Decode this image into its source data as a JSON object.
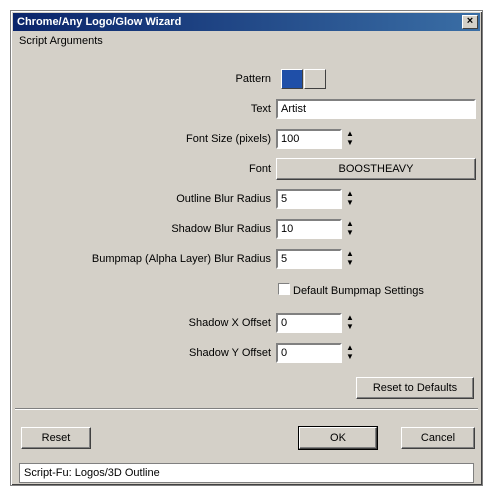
{
  "window": {
    "title": "Chrome/Any Logo/Glow Wizard",
    "close_glyph": "×"
  },
  "group_label": "Script Arguments",
  "fields": {
    "pattern_label": "Pattern",
    "text_label": "Text",
    "text_value": "Artist",
    "font_size_label": "Font Size (pixels)",
    "font_size_value": "100",
    "font_label": "Font",
    "font_value": "BOOSTHEAVY",
    "outline_blur_label": "Outline Blur Radius",
    "outline_blur_value": "5",
    "shadow_blur_label": "Shadow Blur Radius",
    "shadow_blur_value": "10",
    "bump_blur_label": "Bumpmap (Alpha Layer) Blur Radius",
    "bump_blur_value": "5",
    "default_bump_label": "Default Bumpmap Settings",
    "shadow_x_label": "Shadow X Offset",
    "shadow_x_value": "0",
    "shadow_y_label": "Shadow Y Offset",
    "shadow_y_value": "0"
  },
  "buttons": {
    "reset_defaults": "Reset to Defaults",
    "reset": "Reset",
    "ok": "OK",
    "cancel": "Cancel"
  },
  "status_text": "Script-Fu: Logos/3D Outline",
  "colors": {
    "dialog_bg": "#d4d0c8",
    "titlebar": "#0a246a",
    "pattern_swatch": "#1f4fa8"
  },
  "icons": {
    "spin": "spin-arrows-icon"
  }
}
